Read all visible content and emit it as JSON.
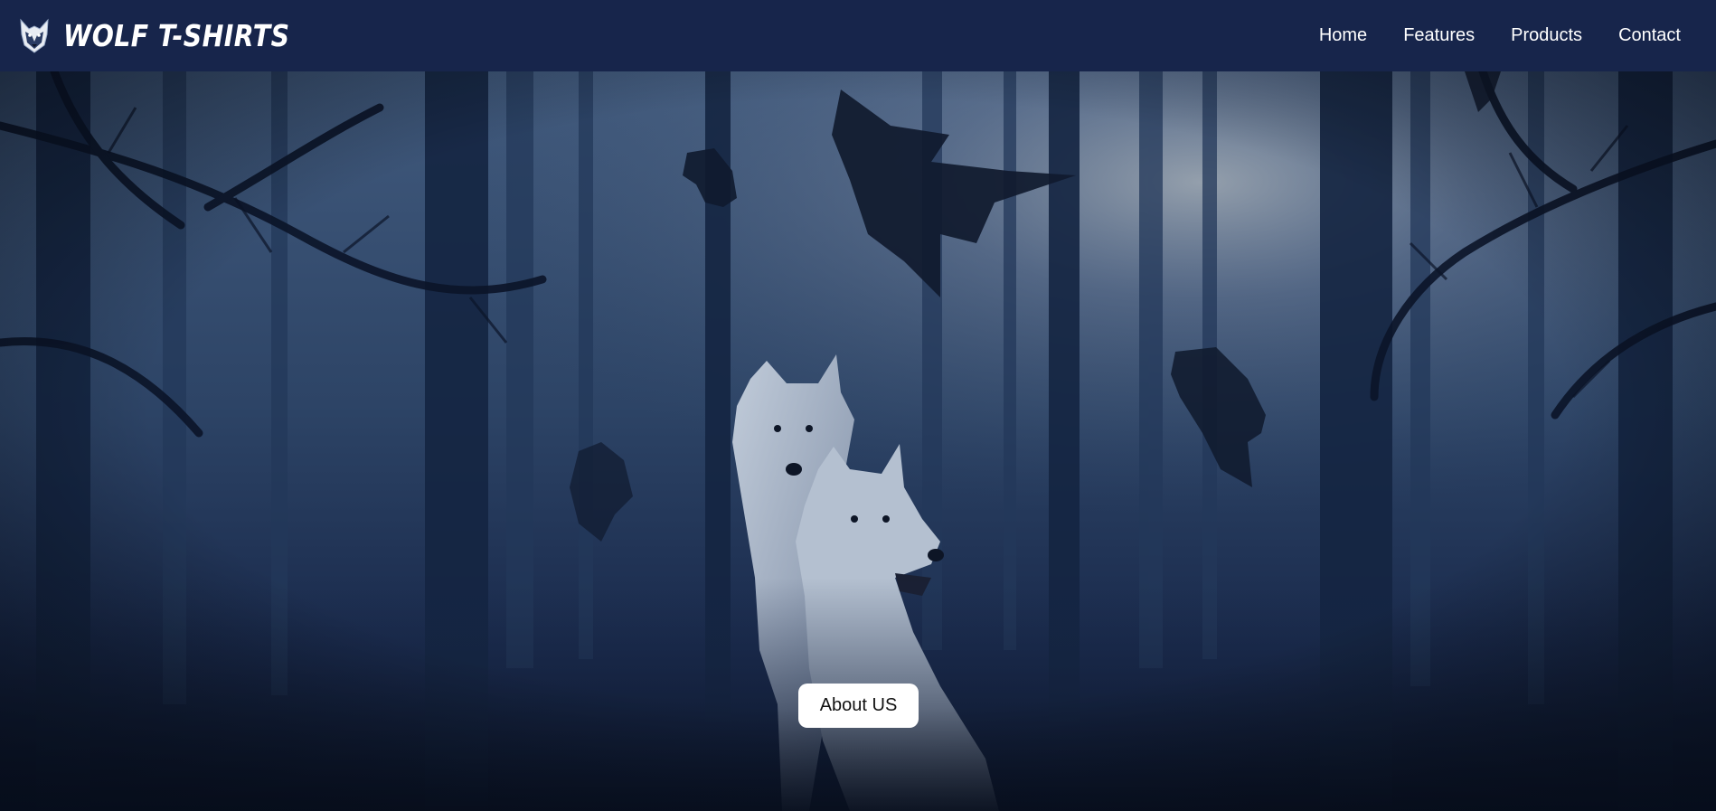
{
  "brand": {
    "name": "WOLF T-SHIRTS",
    "logo_icon": "wolf-head-icon"
  },
  "nav": {
    "links": [
      "Home",
      "Features",
      "Products",
      "Contact"
    ]
  },
  "hero": {
    "background": "misty-forest-with-two-wolves-and-falling-leaves",
    "cta_label": "About US"
  },
  "colors": {
    "navbar_bg": "#17254b",
    "nav_text": "#ffffff",
    "hero_tone": "#2b4366",
    "button_bg": "#ffffff",
    "button_text": "#111111"
  }
}
